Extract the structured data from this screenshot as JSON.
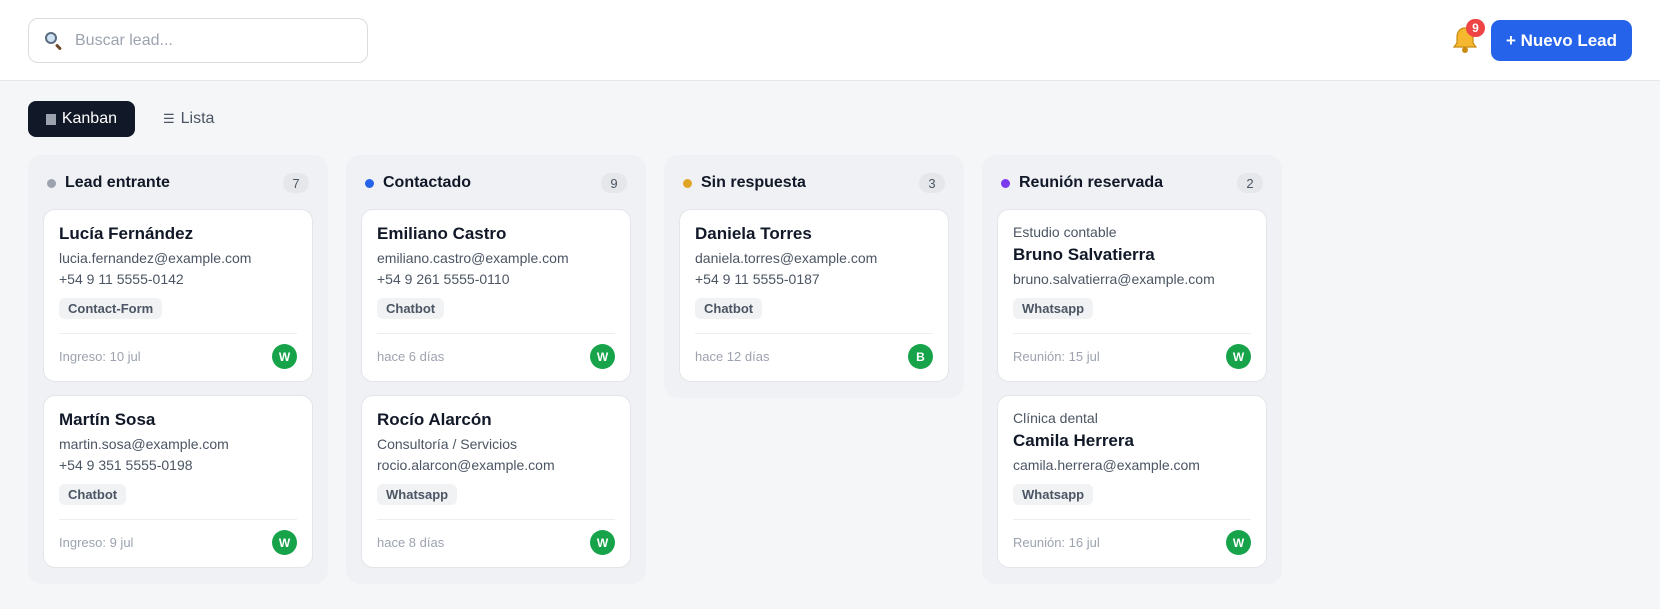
{
  "search": {
    "placeholder": "Buscar lead..."
  },
  "header": {
    "notifications_count": "9",
    "new_lead_label": "+ Nuevo Lead"
  },
  "views": {
    "kanban_label": "Kanban",
    "list_label": "Lista"
  },
  "colors": {
    "primary": "#2563eb",
    "dark": "#111827",
    "avatar": "#16a34a",
    "badge": "#ef4444"
  },
  "columns": [
    {
      "title": "Lead entrante",
      "count": "7",
      "dot_color": "#9ca3af",
      "cards": [
        {
          "company": "",
          "name": "Lucía Fernández",
          "email": "lucia.fernandez@example.com",
          "phone": "+54 9 11 5555-0142",
          "tag": "Contact-Form",
          "footer": "Ingreso: 10 jul",
          "avatar": "W"
        },
        {
          "company": "",
          "name": "Martín Sosa",
          "email": "martin.sosa@example.com",
          "phone": "+54 9 351 5555-0198",
          "tag": "Chatbot",
          "footer": "Ingreso: 9 jul",
          "avatar": "W"
        }
      ]
    },
    {
      "title": "Contactado",
      "count": "9",
      "dot_color": "#2563eb",
      "cards": [
        {
          "company": "",
          "name": "Emiliano Castro",
          "email": "emiliano.castro@example.com",
          "phone": "+54 9 261 5555-0110",
          "tag": "Chatbot",
          "footer": "hace 6 días",
          "avatar": "W"
        },
        {
          "company": "",
          "name": "Rocío Alarcón",
          "email": "Consultoría / Servicios",
          "phone": "rocio.alarcon@example.com",
          "tag": "Whatsapp",
          "footer": "hace 8 días",
          "avatar": "W"
        }
      ]
    },
    {
      "title": "Sin respuesta",
      "count": "3",
      "dot_color": "#e0a526",
      "cards": [
        {
          "company": "",
          "name": "Daniela Torres",
          "email": "daniela.torres@example.com",
          "phone": "+54 9 11 5555-0187",
          "tag": "Chatbot",
          "footer": "hace 12 días",
          "avatar": "B"
        }
      ]
    },
    {
      "title": "Reunión reservada",
      "count": "2",
      "dot_color": "#7c3aed",
      "cards": [
        {
          "company": "Estudio contable",
          "name": "Bruno Salvatierra",
          "email": "bruno.salvatierra@example.com",
          "phone": "",
          "tag": "Whatsapp",
          "footer": "Reunión: 15 jul",
          "avatar": "W"
        },
        {
          "company": "Clínica dental",
          "name": "Camila Herrera",
          "email": "camila.herrera@example.com",
          "phone": "",
          "tag": "Whatsapp",
          "footer": "Reunión: 16 jul",
          "avatar": "W"
        }
      ]
    }
  ]
}
